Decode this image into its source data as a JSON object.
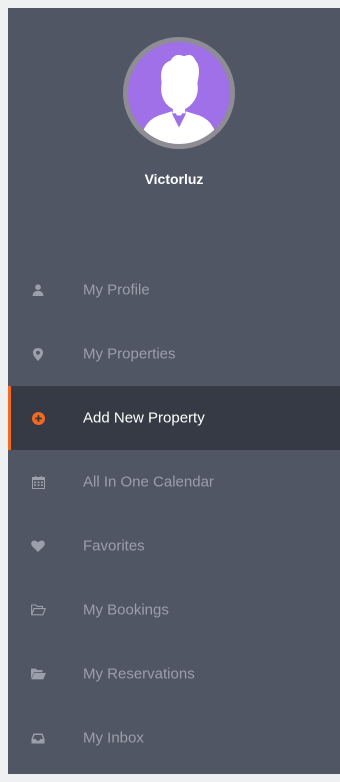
{
  "user": {
    "name": "Victorluz"
  },
  "colors": {
    "sidebar_bg": "#505664",
    "active_bg": "#363a45",
    "accent": "#f26a21",
    "avatar_bg": "#a070e8",
    "muted_text": "#9a9faa"
  },
  "menu": {
    "items": [
      {
        "label": "My Profile",
        "icon": "user-icon",
        "active": false
      },
      {
        "label": "My Properties",
        "icon": "map-marker-icon",
        "active": false
      },
      {
        "label": "Add New Property",
        "icon": "plus-circle-icon",
        "active": true
      },
      {
        "label": "All In One Calendar",
        "icon": "calendar-icon",
        "active": false
      },
      {
        "label": "Favorites",
        "icon": "heart-icon",
        "active": false
      },
      {
        "label": "My Bookings",
        "icon": "folder-open-outline-icon",
        "active": false
      },
      {
        "label": "My Reservations",
        "icon": "folder-open-icon",
        "active": false
      },
      {
        "label": "My Inbox",
        "icon": "inbox-icon",
        "active": false
      }
    ]
  }
}
